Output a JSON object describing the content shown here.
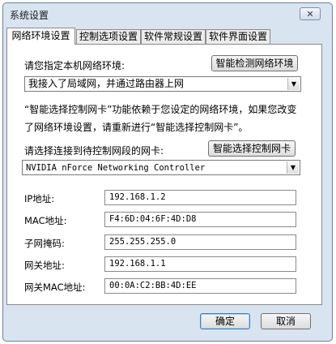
{
  "window": {
    "title": "系统设置",
    "close_glyph": "✕"
  },
  "tabs": [
    {
      "label": "网络环境设置",
      "active": true
    },
    {
      "label": "控制选项设置",
      "active": false
    },
    {
      "label": "软件常规设置",
      "active": false
    },
    {
      "label": "软件界面设置",
      "active": false
    }
  ],
  "network": {
    "env_label": "请您指定本机网络环境:",
    "detect_button": "智能检测网络环境",
    "env_selected": "我接入了局域网，并通过路由器上网",
    "hint_line1": "“智能选择控制网卡”功能依赖于您设定的网络环境，如果您改变",
    "hint_line2": "了网络环境设置，请重新进行“智能选择控制网卡”。",
    "nic_label": "请选择连接到待控制网段的网卡:",
    "nic_button": "智能选择控制网卡",
    "nic_selected": "NVIDIA nForce Networking Controller"
  },
  "fields": [
    {
      "label": "IP地址:",
      "value": "192.168.1.2"
    },
    {
      "label": "MAC地址:",
      "value": "F4:6D:04:6F:4D:D8"
    },
    {
      "label": "子网掩码:",
      "value": "255.255.255.0"
    },
    {
      "label": "网关地址:",
      "value": "192.168.1.1"
    },
    {
      "label": "网关MAC地址:",
      "value": "00:0A:C2:BB:4D:EE"
    }
  ],
  "footer": {
    "ok_label": "确定",
    "cancel_label": "取消"
  },
  "icons": {
    "dropdown": "dropdown-arrow-icon",
    "close": "close-icon"
  }
}
